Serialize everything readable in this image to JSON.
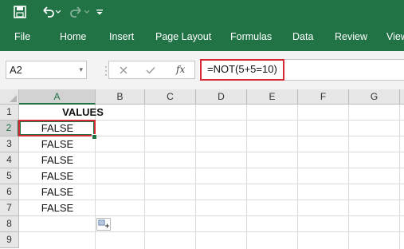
{
  "quick_access": {
    "save_icon": "save-icon",
    "undo_icon": "undo-icon",
    "redo_icon": "redo-icon",
    "customize_icon": "customize-toolbar-icon"
  },
  "ribbon": {
    "tabs": [
      "File",
      "Home",
      "Insert",
      "Page Layout",
      "Formulas",
      "Data",
      "Review",
      "View"
    ]
  },
  "formula_bar": {
    "name_box": "A2",
    "formula": "=NOT(5+5=10)",
    "cancel_icon": "cancel-icon",
    "enter_icon": "enter-icon",
    "function_icon": "insert-function-icon",
    "fx_label": "fx"
  },
  "sheet": {
    "columns": [
      "A",
      "B",
      "C",
      "D",
      "E",
      "F",
      "G"
    ],
    "rows": [
      "1",
      "2",
      "3",
      "4",
      "5",
      "6",
      "7",
      "8",
      "9"
    ],
    "active_cell": "A2",
    "cells": {
      "A1": "VALUES",
      "A2": "FALSE",
      "A3": "FALSE",
      "A4": "FALSE",
      "A5": "FALSE",
      "A6": "FALSE",
      "A7": "FALSE"
    }
  },
  "colors": {
    "excel_green": "#217346",
    "highlight_red": "#d42a36"
  }
}
